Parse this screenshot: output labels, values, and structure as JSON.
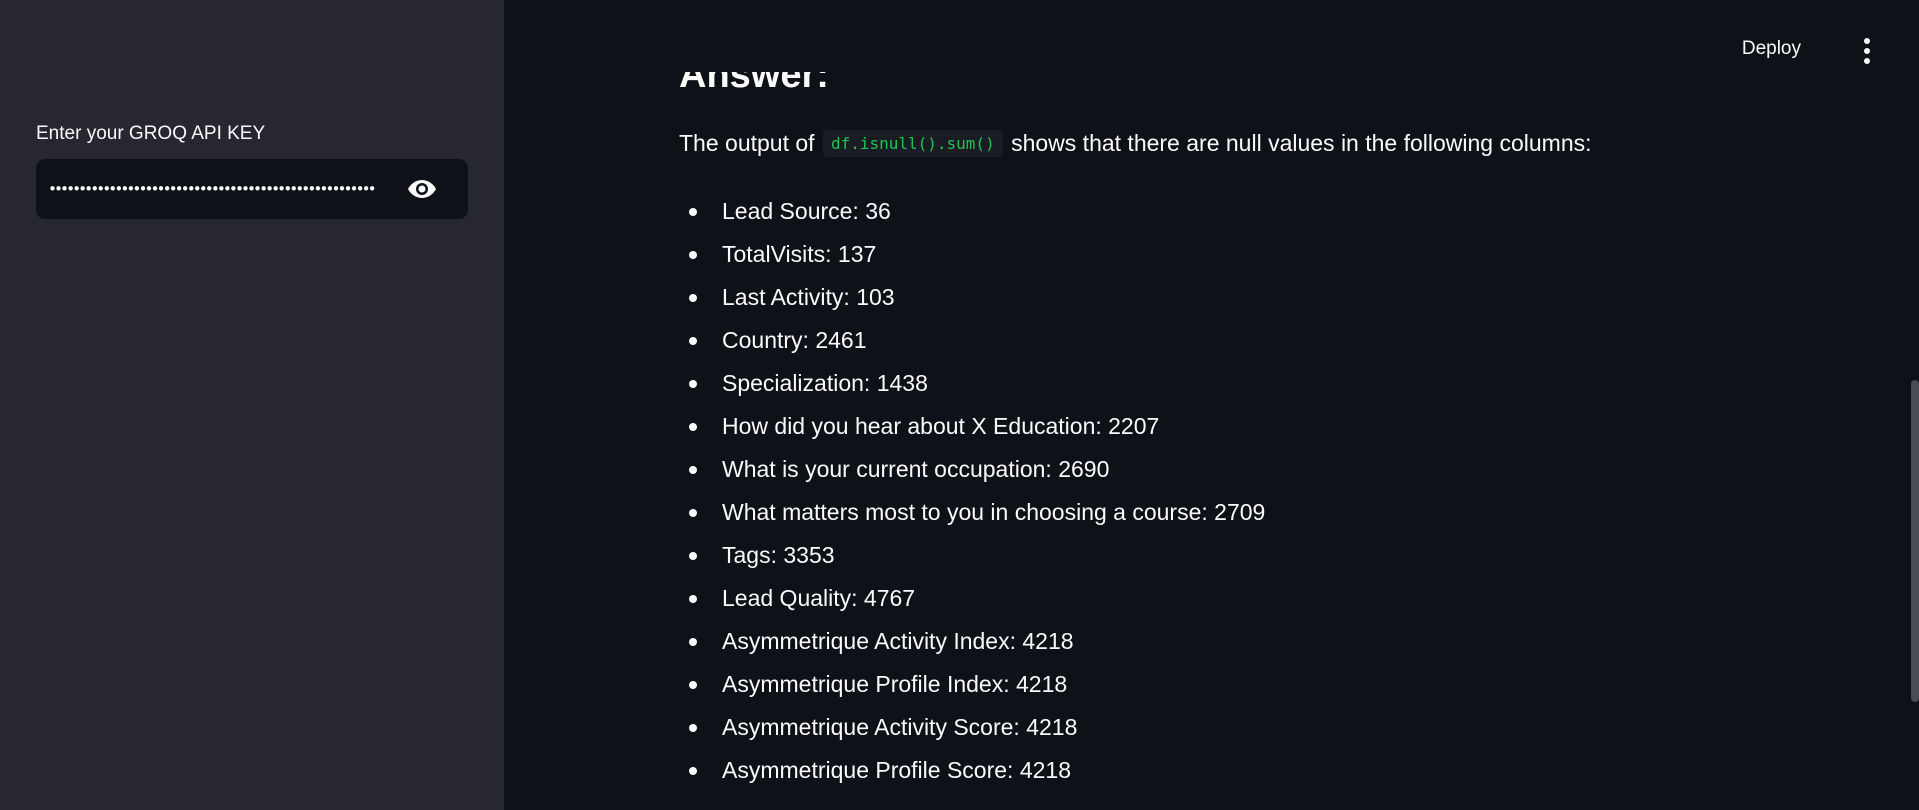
{
  "sidebar": {
    "api_key_label": "Enter your GROQ API KEY",
    "api_key_value": "••••••••••••••••••••••••••••••••••••••••••••••••••••••"
  },
  "header": {
    "deploy_label": "Deploy"
  },
  "main": {
    "heading": "Answer:",
    "intro_before": "The output of ",
    "intro_code": "df.isnull().sum()",
    "intro_after": " shows that there are null values in the following columns:",
    "items": [
      "Lead Source: 36",
      "TotalVisits: 137",
      "Last Activity: 103",
      "Country: 2461",
      "Specialization: 1438",
      "How did you hear about X Education: 2207",
      "What is your current occupation: 2690",
      "What matters most to you in choosing a course: 2709",
      "Tags: 3353",
      "Lead Quality: 4767",
      "Asymmetrique Activity Index: 4218",
      "Asymmetrique Profile Index: 4218",
      "Asymmetrique Activity Score: 4218",
      "Asymmetrique Profile Score: 4218"
    ]
  },
  "icons": {
    "password_toggle": "eye-icon",
    "main_menu": "vertical-dots-icon"
  },
  "colors": {
    "sidebar_bg": "#262730",
    "main_bg": "#0e1117",
    "code_text": "#21c354"
  }
}
